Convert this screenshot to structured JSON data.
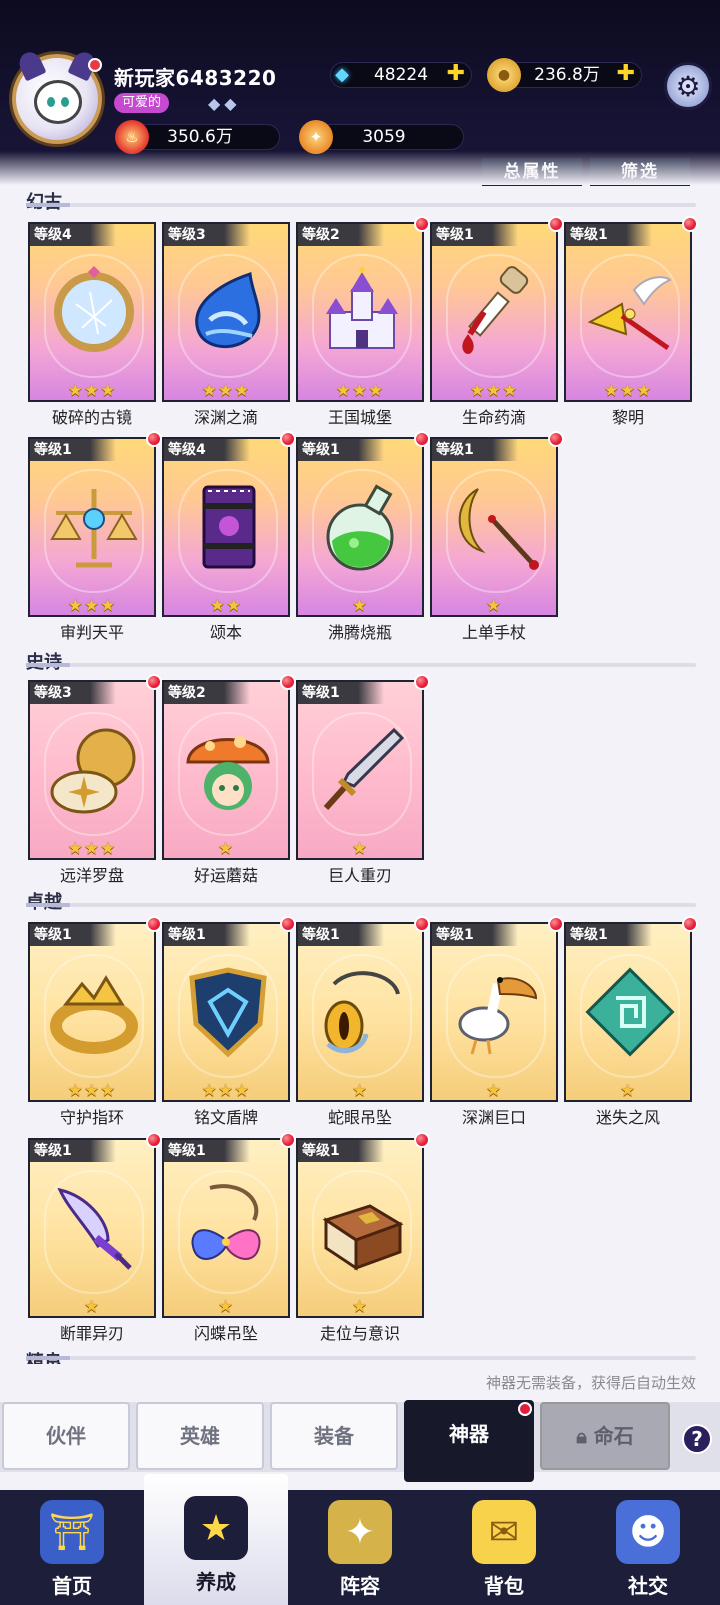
{
  "player": {
    "name": "新玩家6483220",
    "title_badge": "可爱的",
    "rank_gems": "◆◆"
  },
  "currencies": {
    "gems": "48224",
    "coins": "236.8万",
    "power": "350.6万",
    "stars": "3059",
    "plus": "✚"
  },
  "header_buttons": {
    "total_attr": "总属性",
    "filter": "筛选"
  },
  "sections": {
    "mythic": "幻古",
    "epic": "史诗",
    "legendary": "卓越",
    "elite": "精良"
  },
  "cards": [
    {
      "level": "等级4",
      "name": "破碎的古镜",
      "stars": "★★★",
      "red_dot": false,
      "icon": "mirror-icon"
    },
    {
      "level": "等级3",
      "name": "深渊之滴",
      "stars": "★★★",
      "red_dot": false,
      "icon": "water-drop-icon"
    },
    {
      "level": "等级2",
      "name": "王国城堡",
      "stars": "★★★",
      "red_dot": true,
      "icon": "castle-icon"
    },
    {
      "level": "等级1",
      "name": "生命药滴",
      "stars": "★★★",
      "red_dot": true,
      "icon": "dropper-icon"
    },
    {
      "level": "等级1",
      "name": "黎明",
      "stars": "★★★",
      "red_dot": true,
      "icon": "winged-spear-icon"
    },
    {
      "level": "等级1",
      "name": "审判天平",
      "stars": "★★★",
      "red_dot": true,
      "icon": "scales-icon"
    },
    {
      "level": "等级4",
      "name": "颂本",
      "stars": "★★",
      "red_dot": true,
      "icon": "book-icon"
    },
    {
      "level": "等级1",
      "name": "沸腾烧瓶",
      "stars": "★",
      "red_dot": true,
      "icon": "flask-icon"
    },
    {
      "level": "等级1",
      "name": "上单手杖",
      "stars": "★",
      "red_dot": true,
      "icon": "moon-staff-icon"
    },
    {
      "level": "等级3",
      "name": "远洋罗盘",
      "stars": "★★★",
      "red_dot": true,
      "icon": "compass-icon"
    },
    {
      "level": "等级2",
      "name": "好运蘑菇",
      "stars": "★",
      "red_dot": true,
      "icon": "mushroom-icon"
    },
    {
      "level": "等级1",
      "name": "巨人重刃",
      "stars": "★",
      "red_dot": true,
      "icon": "sword-icon"
    },
    {
      "level": "等级1",
      "name": "守护指环",
      "stars": "★★★",
      "red_dot": true,
      "icon": "ring-icon"
    },
    {
      "level": "等级1",
      "name": "铭文盾牌",
      "stars": "★★★",
      "red_dot": true,
      "icon": "shield-icon"
    },
    {
      "level": "等级1",
      "name": "蛇眼吊坠",
      "stars": "★",
      "red_dot": true,
      "icon": "snake-pendant-icon"
    },
    {
      "level": "等级1",
      "name": "深渊巨口",
      "stars": "★",
      "red_dot": true,
      "icon": "pelican-icon"
    },
    {
      "level": "等级1",
      "name": "迷失之风",
      "stars": "★",
      "red_dot": true,
      "icon": "spiral-rune-icon"
    },
    {
      "level": "等级1",
      "name": "断罪异刃",
      "stars": "★",
      "red_dot": true,
      "icon": "dagger-icon"
    },
    {
      "level": "等级1",
      "name": "闪蝶吊坠",
      "stars": "★",
      "red_dot": true,
      "icon": "butterfly-pendant-icon"
    },
    {
      "level": "等级1",
      "name": "走位与意识",
      "stars": "★",
      "red_dot": true,
      "icon": "tome-icon"
    }
  ],
  "note": "神器无需装备，获得后自动生效",
  "tabs": [
    "伙伴",
    "英雄",
    "装备",
    "神器",
    "命石"
  ],
  "help": "?",
  "bottom_nav": [
    "首页",
    "养成",
    "阵容",
    "背包",
    "社交"
  ],
  "colors": {
    "header_bg": "#151232",
    "mythic_card": "#f4a7d4",
    "epic_card": "#ffbccd",
    "legendary_card": "#ffe2a0",
    "active_tab": "#17192a",
    "red_dot": "#e31c3a",
    "star": "#f7c23c"
  }
}
